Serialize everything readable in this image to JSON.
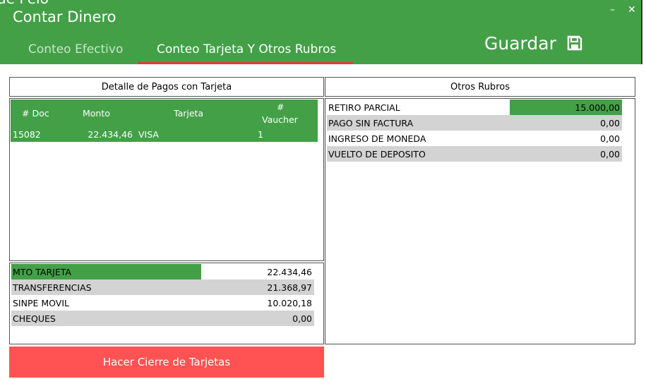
{
  "window": {
    "cut_title": "de Pelo",
    "title": "Contar Dinero",
    "minimize_glyph": "–",
    "close_glyph": "✕"
  },
  "tabs": [
    {
      "label": "Conteo Efectivo",
      "active": false
    },
    {
      "label": "Conteo Tarjeta Y Otros Rubros",
      "active": true
    }
  ],
  "save": {
    "label": "Guardar",
    "icon": "floppy-disk-icon"
  },
  "card_panel": {
    "title": "Detalle de Pagos con Tarjeta",
    "columns": [
      "# Doc",
      "Monto",
      "Tarjeta",
      "#",
      "Vaucher"
    ],
    "rows": [
      {
        "doc": "15082",
        "monto": "22.434,46",
        "tarjeta": "VISA",
        "vaucher": "1"
      }
    ]
  },
  "summary": [
    {
      "label": "MTO TARJETA",
      "value": "22.434,46"
    },
    {
      "label": "TRANSFERENCIAS",
      "value": "21.368,97"
    },
    {
      "label": "SINPE MOVIL",
      "value": "10.020,18"
    },
    {
      "label": "CHEQUES",
      "value": "0,00"
    }
  ],
  "other_panel": {
    "title": "Otros Rubros",
    "rows": [
      {
        "label": "RETIRO PARCIAL",
        "value": "15.000,00"
      },
      {
        "label": "PAGO SIN FACTURA",
        "value": "0,00"
      },
      {
        "label": "INGRESO DE MONEDA",
        "value": "0,00"
      },
      {
        "label": "VUELTO DE DEPOSITO",
        "value": "0,00"
      }
    ]
  },
  "actions": {
    "close_cards": "Hacer Cierre de Tarjetas"
  },
  "colors": {
    "accent_green": "#43a047",
    "danger_red": "#ff5252",
    "tab_underline": "#e53935",
    "row_gray": "#d3d3d3"
  }
}
